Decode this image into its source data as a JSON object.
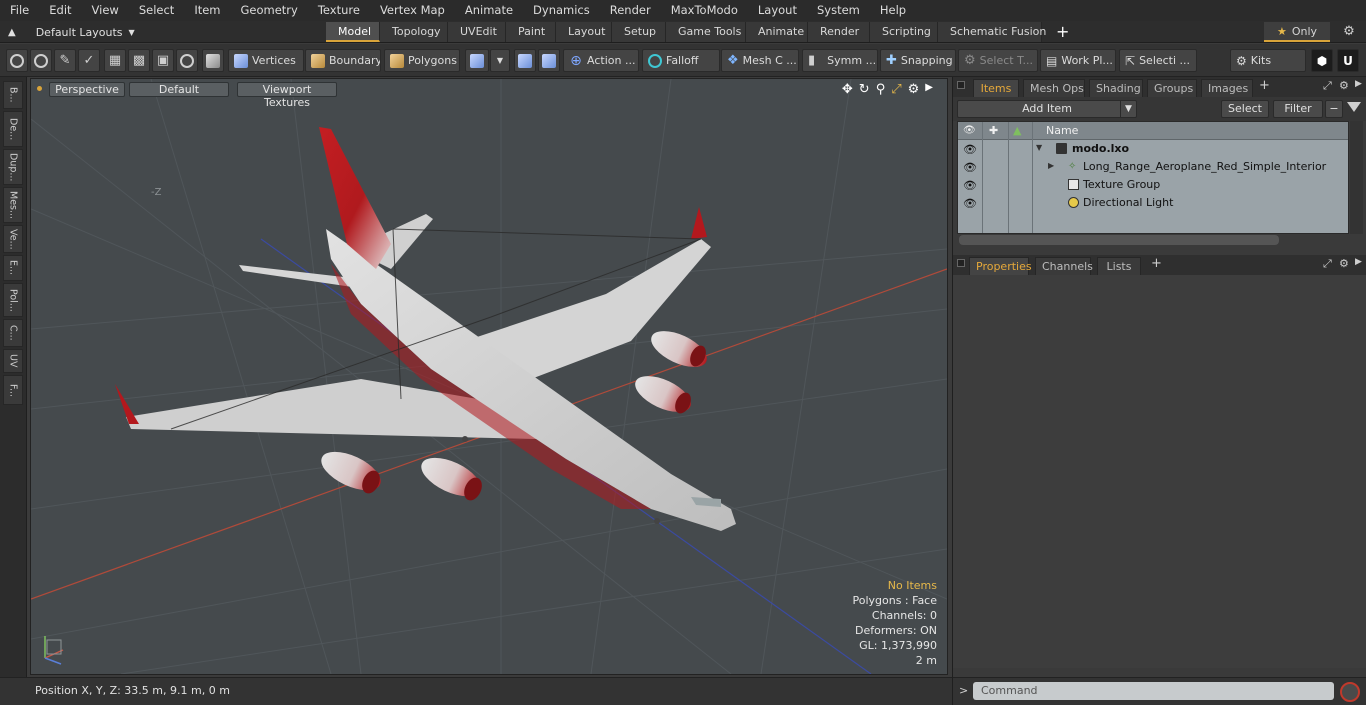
{
  "menu": [
    "File",
    "Edit",
    "View",
    "Select",
    "Item",
    "Geometry",
    "Texture",
    "Vertex Map",
    "Animate",
    "Dynamics",
    "Render",
    "MaxToModo",
    "Layout",
    "System",
    "Help"
  ],
  "layouts_label": "Default Layouts",
  "layout_tabs": [
    "Model",
    "Topology",
    "UVEdit",
    "Paint",
    "Layout",
    "Setup",
    "Game Tools",
    "Animate",
    "Render",
    "Scripting",
    "Schematic Fusion"
  ],
  "active_layout_tab": "Model",
  "only_label": "Only",
  "toolbar": {
    "vertices": "Vertices",
    "boundary": "Boundary",
    "polygons": "Polygons",
    "action": "Action ...",
    "falloff": "Falloff",
    "mesh_c": "Mesh C ...",
    "symm": "Symm ...",
    "snapping": "Snapping",
    "select_t": "Select T...",
    "work_pl": "Work Pl...",
    "selecti": "Selecti ...",
    "kits": "Kits"
  },
  "left_tabs": [
    "B...",
    "De...",
    "Dup...",
    "Mes...",
    "Ve...",
    "E...",
    "Pol...",
    "C...",
    "UV",
    "F..."
  ],
  "viewport": {
    "view_mode": "Perspective",
    "shading": "Default",
    "textures": "Viewport Textures",
    "axis_label": "-Z",
    "stats": {
      "no_items": "No Items",
      "polygons": "Polygons : Face",
      "channels": "Channels: 0",
      "deformers": "Deformers: ON",
      "gl": "GL: 1,373,990",
      "scale": "2 m"
    }
  },
  "status": {
    "position": "Position X, Y, Z:   33.5 m, 9.1 m, 0 m"
  },
  "items_panel": {
    "tabs": [
      "Items",
      "Mesh Ops",
      "Shading",
      "Groups",
      "Images"
    ],
    "active_tab": "Items",
    "add_item": "Add Item",
    "select": "Select",
    "filter": "Filter",
    "col_name": "Name",
    "tree": [
      {
        "label": "modo.lxo",
        "bold": true,
        "indent": 0
      },
      {
        "label": "Long_Range_Aeroplane_Red_Simple_Interior",
        "bold": false,
        "indent": 1
      },
      {
        "label": "Texture Group",
        "bold": false,
        "indent": 1
      },
      {
        "label": "Directional Light",
        "bold": false,
        "indent": 1
      }
    ]
  },
  "props_panel": {
    "tabs": [
      "Properties",
      "Channels",
      "Lists"
    ],
    "active_tab": "Properties"
  },
  "command": {
    "placeholder": "Command"
  },
  "colors": {
    "accent": "#d9a43a",
    "livery_red": "#b3181d",
    "viewport_bg": "#454a4d"
  }
}
